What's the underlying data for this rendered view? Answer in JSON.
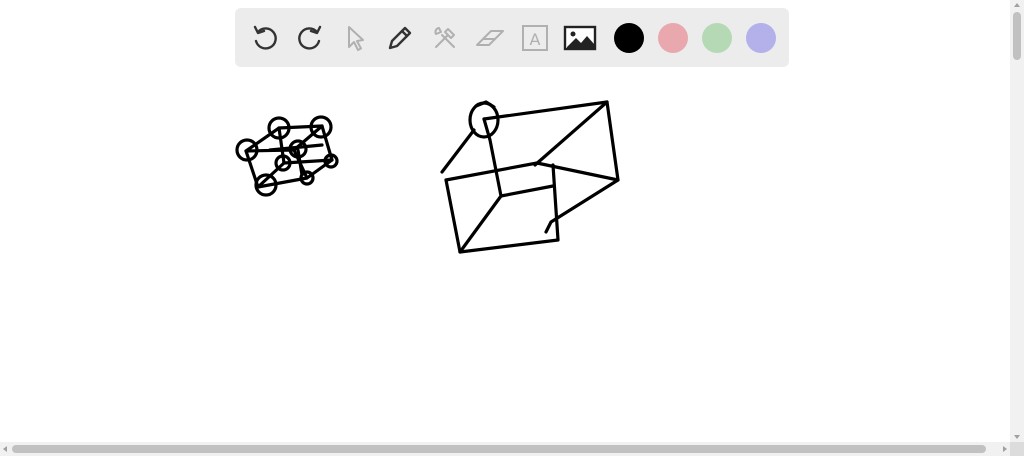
{
  "toolbar": {
    "tools": [
      {
        "id": "undo",
        "icon": "undo-icon",
        "enabled": true
      },
      {
        "id": "redo",
        "icon": "redo-icon",
        "enabled": true
      },
      {
        "id": "select",
        "icon": "cursor-arrow-icon",
        "enabled": false
      },
      {
        "id": "pen",
        "icon": "pencil-icon",
        "enabled": true
      },
      {
        "id": "tools",
        "icon": "hammer-wrench-icon",
        "enabled": false
      },
      {
        "id": "eraser",
        "icon": "eraser-icon",
        "enabled": false
      },
      {
        "id": "text",
        "icon": "text-box-icon",
        "enabled": false
      },
      {
        "id": "image",
        "icon": "image-icon",
        "enabled": true
      }
    ],
    "colors": [
      {
        "name": "black",
        "hex": "#000000"
      },
      {
        "name": "pink",
        "hex": "#e8a8ae"
      },
      {
        "name": "green",
        "hex": "#b5d9b5"
      },
      {
        "name": "purple",
        "hex": "#b3b0ea"
      }
    ],
    "text_tool_glyph": "A"
  },
  "colors": {
    "toolbar_bg": "#ececec",
    "icon_active": "#333333",
    "icon_disabled": "#b0b0b0",
    "ink": "#000000"
  }
}
